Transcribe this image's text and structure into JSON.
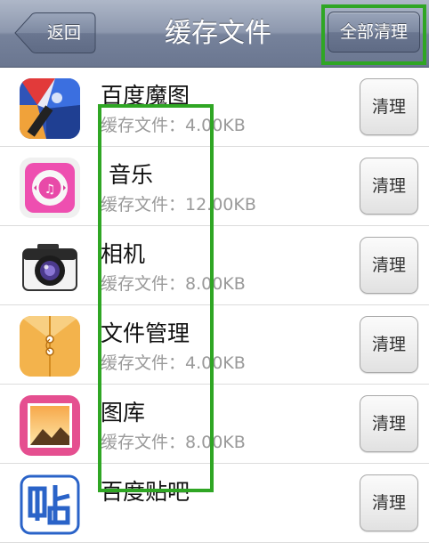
{
  "navbar": {
    "back_label": "返回",
    "title": "缓存文件",
    "clear_all_label": "全部清理"
  },
  "apps": [
    {
      "name": "百度魔图",
      "cache": "缓存文件：4.00KB",
      "button": "清理",
      "icon": "baidu-motu-icon"
    },
    {
      "name": " 音乐",
      "cache": "缓存文件：12.00KB",
      "button": "清理",
      "icon": "music-icon"
    },
    {
      "name": "相机",
      "cache": "缓存文件：8.00KB",
      "button": "清理",
      "icon": "camera-icon"
    },
    {
      "name": "文件管理",
      "cache": "缓存文件：4.00KB",
      "button": "清理",
      "icon": "file-manager-icon"
    },
    {
      "name": "图库",
      "cache": "缓存文件：8.00KB",
      "button": "清理",
      "icon": "gallery-icon"
    },
    {
      "name": "百度贴吧",
      "cache": "",
      "button": "清理",
      "icon": "baidu-tieba-icon"
    }
  ],
  "colors": {
    "highlight": "#2fa624",
    "navbar": "#7d89a1"
  }
}
